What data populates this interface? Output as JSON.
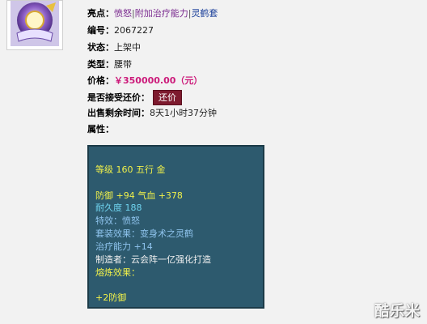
{
  "item": {
    "highlights": {
      "label": "亮点：",
      "part1": "愤怒",
      "part2": "附加治疗能力",
      "part3": "灵鹤套"
    },
    "number": {
      "label": "编号：",
      "value": "2067227"
    },
    "status": {
      "label": "状态：",
      "value": "上架中"
    },
    "type": {
      "label": "类型：",
      "value": "腰带"
    },
    "price": {
      "label": "价格：",
      "value": "￥350000.00（元）"
    },
    "bargain": {
      "label": "是否接受还价：",
      "button": "还价"
    },
    "remaining": {
      "label": "出售剩余时间：",
      "value": "8天1小时37分钟"
    },
    "attributes": {
      "label": "属性："
    }
  },
  "panel": {
    "level_line": "等级 160  五行 金",
    "defense_line": "防御 +94  气血 +378",
    "durability_line": "耐久度 188",
    "special_line": "特效：愤怒",
    "set_line": "套装效果：变身术之灵鹤",
    "heal_line": "治疗能力 +14",
    "maker_line": "制造者：云会阵一亿强化打造",
    "refine_line": "熔炼效果：",
    "refine_value": "+2防御"
  },
  "watermark": "酷乐米",
  "colors": {
    "panel_bg": "#2d5a6e",
    "yellow": "#f0f04a",
    "cyan": "#6fd4f0",
    "price": "#cc1a7a",
    "button": "#7d1a2e"
  }
}
